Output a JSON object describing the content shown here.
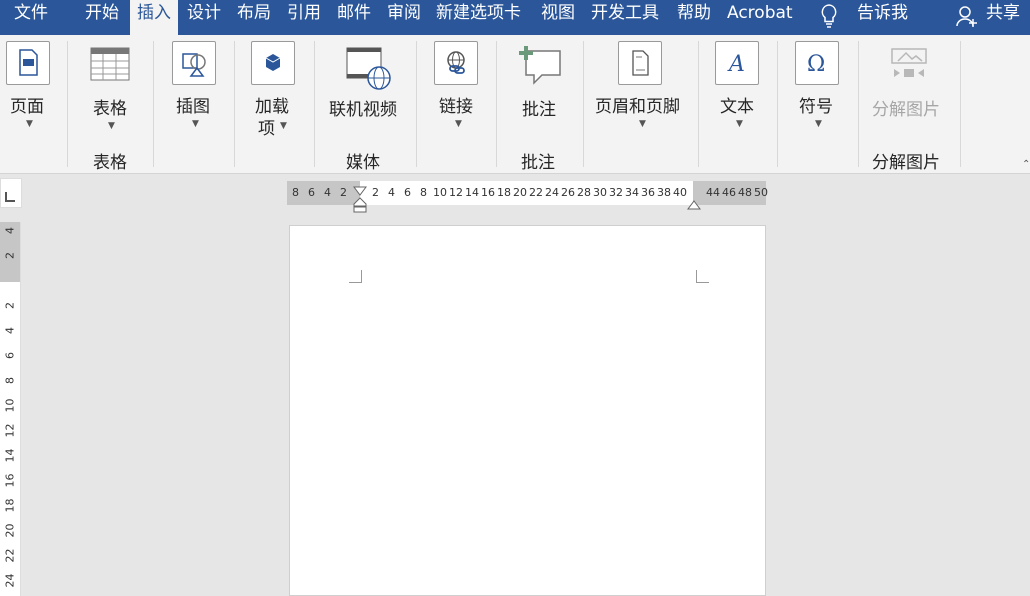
{
  "tabs": [
    "文件",
    "开始",
    "插入",
    "设计",
    "布局",
    "引用",
    "邮件",
    "审阅",
    "新建选项卡",
    "视图",
    "开发工具",
    "帮助",
    "Acrobat"
  ],
  "active_tab": "插入",
  "tell_me": "告诉我",
  "share": "共享",
  "ribbon": {
    "page": "页面",
    "table": "表格",
    "illustrations": "插图",
    "addins_line1": "加载",
    "addins_line2": "项",
    "online_video": "联机视频",
    "link": "链接",
    "comment": "批注",
    "header_footer": "页眉和页脚",
    "text": "文本",
    "symbol": "符号",
    "split_picture": "分解图片"
  },
  "groups": {
    "table": "表格",
    "media": "媒体",
    "comments": "批注",
    "split_picture": "分解图片"
  },
  "hruler_ticks": [
    "8",
    "6",
    "4",
    "2",
    "2",
    "4",
    "6",
    "8",
    "10",
    "12",
    "14",
    "16",
    "18",
    "20",
    "22",
    "24",
    "26",
    "28",
    "30",
    "32",
    "34",
    "36",
    "38",
    "40",
    "44",
    "46",
    "48",
    "50"
  ],
  "vruler_ticks": [
    "4",
    "2",
    "2",
    "4",
    "6",
    "8",
    "10",
    "12",
    "14",
    "16",
    "18",
    "20",
    "22",
    "24"
  ],
  "colors": {
    "tab_bar": "#2b579a",
    "ribbon": "#f3f3f3",
    "workspace": "#e6e6e6"
  }
}
